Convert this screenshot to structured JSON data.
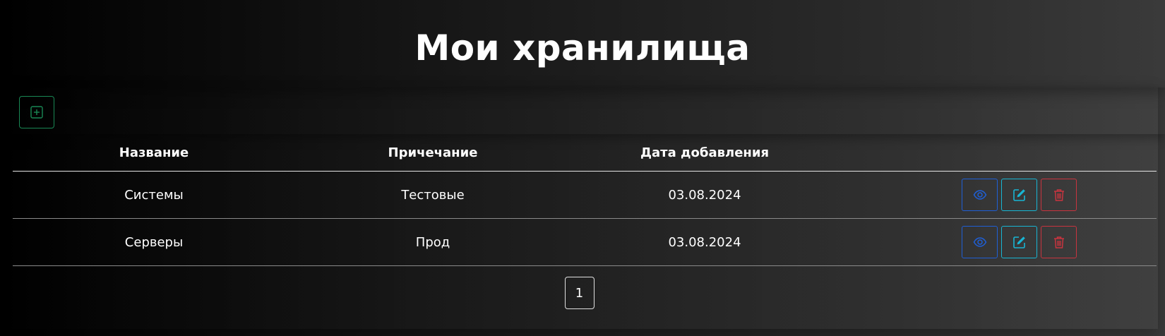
{
  "page": {
    "title": "Мои хранилища"
  },
  "table": {
    "headers": {
      "name": "Название",
      "note": "Причечание",
      "date": "Дата добавления"
    },
    "rows": [
      {
        "name": "Системы",
        "note": "Тестовые",
        "date": "03.08.2024"
      },
      {
        "name": "Серверы",
        "note": "Прод",
        "date": "03.08.2024"
      }
    ]
  },
  "pagination": {
    "current_page": "1"
  },
  "icons": {
    "add": "plus-square-icon",
    "view": "eye-icon",
    "edit": "pencil-square-icon",
    "delete": "trash-icon"
  },
  "colors": {
    "add": "#198754",
    "view": "#1f5fd6",
    "edit": "#18b6d4",
    "delete": "#c9343f"
  }
}
